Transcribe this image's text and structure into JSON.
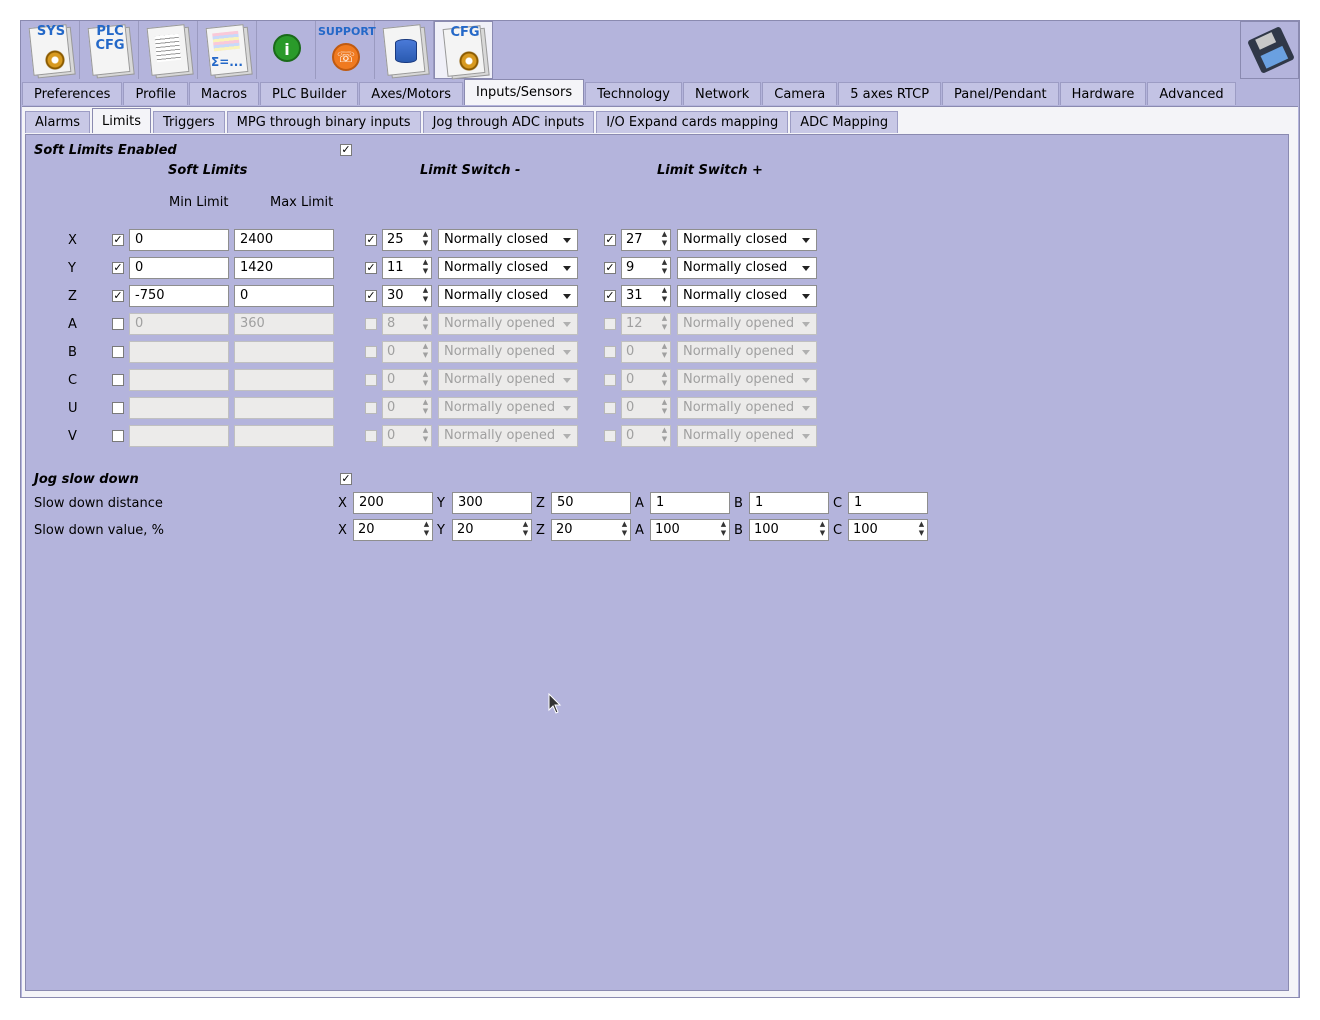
{
  "toolbar": {
    "buttons": [
      {
        "name": "sys-config-button",
        "text": "SYS"
      },
      {
        "name": "plc-config-button",
        "text": "PLC CFG"
      },
      {
        "name": "document-button",
        "text": ""
      },
      {
        "name": "report-button",
        "text": "Σ=..."
      },
      {
        "name": "info-button",
        "text": "i"
      },
      {
        "name": "support-button",
        "text": "SUPPORT"
      },
      {
        "name": "database-button",
        "text": ""
      },
      {
        "name": "cfg-button",
        "text": "CFG"
      }
    ]
  },
  "main_tabs": [
    "Preferences",
    "Profile",
    "Macros",
    "PLC Builder",
    "Axes/Motors",
    "Inputs/Sensors",
    "Technology",
    "Network",
    "Camera",
    "5 axes RTCP",
    "Panel/Pendant",
    "Hardware",
    "Advanced"
  ],
  "sub_tabs": [
    "Alarms",
    "Limits",
    "Triggers",
    "MPG through binary inputs",
    "Jog through ADC inputs",
    "I/O Expand cards mapping",
    "ADC Mapping"
  ],
  "soft_limits": {
    "enabled_label": "Soft Limits Enabled",
    "enabled": true,
    "group_title": "Soft Limits",
    "min_header": "Min Limit",
    "max_header": "Max Limit",
    "switch_minus_title": "Limit Switch -",
    "switch_plus_title": "Limit Switch +"
  },
  "axes": [
    {
      "axis": "X",
      "enabled": true,
      "min": "0",
      "max": "2400",
      "minus_on": true,
      "minus_pin": "25",
      "minus_type": "Normally closed",
      "plus_on": true,
      "plus_pin": "27",
      "plus_type": "Normally closed"
    },
    {
      "axis": "Y",
      "enabled": true,
      "min": "0",
      "max": "1420",
      "minus_on": true,
      "minus_pin": "11",
      "minus_type": "Normally closed",
      "plus_on": true,
      "plus_pin": "9",
      "plus_type": "Normally closed"
    },
    {
      "axis": "Z",
      "enabled": true,
      "min": "-750",
      "max": "0",
      "minus_on": true,
      "minus_pin": "30",
      "minus_type": "Normally closed",
      "plus_on": true,
      "plus_pin": "31",
      "plus_type": "Normally closed"
    },
    {
      "axis": "A",
      "enabled": false,
      "min": "0",
      "max": "360",
      "minus_on": false,
      "minus_pin": "8",
      "minus_type": "Normally opened",
      "plus_on": false,
      "plus_pin": "12",
      "plus_type": "Normally opened"
    },
    {
      "axis": "B",
      "enabled": false,
      "min": "",
      "max": "",
      "minus_on": false,
      "minus_pin": "0",
      "minus_type": "Normally opened",
      "plus_on": false,
      "plus_pin": "0",
      "plus_type": "Normally opened"
    },
    {
      "axis": "C",
      "enabled": false,
      "min": "",
      "max": "",
      "minus_on": false,
      "minus_pin": "0",
      "minus_type": "Normally opened",
      "plus_on": false,
      "plus_pin": "0",
      "plus_type": "Normally opened"
    },
    {
      "axis": "U",
      "enabled": false,
      "min": "",
      "max": "",
      "minus_on": false,
      "minus_pin": "0",
      "minus_type": "Normally opened",
      "plus_on": false,
      "plus_pin": "0",
      "plus_type": "Normally opened"
    },
    {
      "axis": "V",
      "enabled": false,
      "min": "",
      "max": "",
      "minus_on": false,
      "minus_pin": "0",
      "minus_type": "Normally opened",
      "plus_on": false,
      "plus_pin": "0",
      "plus_type": "Normally opened"
    }
  ],
  "jog": {
    "label": "Jog slow down",
    "enabled": true,
    "distance_label": "Slow down distance",
    "distance": [
      {
        "axis": "X",
        "value": "200"
      },
      {
        "axis": "Y",
        "value": "300"
      },
      {
        "axis": "Z",
        "value": "50"
      },
      {
        "axis": "A",
        "value": "1"
      },
      {
        "axis": "B",
        "value": "1"
      },
      {
        "axis": "C",
        "value": "1"
      }
    ],
    "value_label": "Slow down value, %",
    "value": [
      {
        "axis": "X",
        "value": "20"
      },
      {
        "axis": "Y",
        "value": "20"
      },
      {
        "axis": "Z",
        "value": "20"
      },
      {
        "axis": "A",
        "value": "100"
      },
      {
        "axis": "B",
        "value": "100"
      },
      {
        "axis": "C",
        "value": "100"
      }
    ]
  },
  "colors": {
    "panel_bg": "#b4b4dc",
    "active_tab": "#f4f4f8"
  }
}
